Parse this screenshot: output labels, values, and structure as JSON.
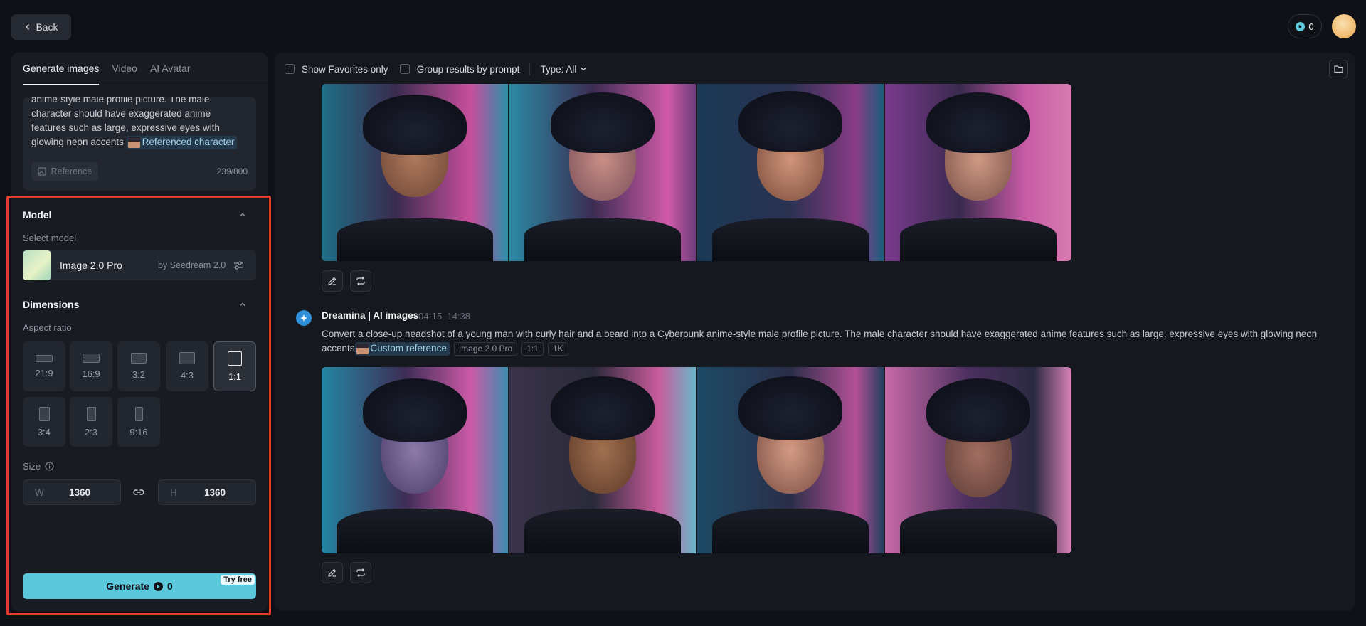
{
  "header": {
    "back_label": "Back",
    "credits": "0"
  },
  "left_panel": {
    "tabs": [
      {
        "label": "Generate images",
        "active": true
      },
      {
        "label": "Video",
        "active": false
      },
      {
        "label": "AI Avatar",
        "active": false
      }
    ],
    "prompt": {
      "lines": [
        "anime-style male profile picture. The male",
        "character should have exaggerated anime",
        "features such as large, expressive eyes with",
        "glowing neon accents"
      ],
      "reference_chip": "Referenced character",
      "reference_button": "Reference",
      "counter": "239/800"
    },
    "model_section": {
      "title": "Model",
      "select_label": "Select model",
      "model_name": "Image 2.0 Pro",
      "model_by": "by Seedream 2.0"
    },
    "dimensions_section": {
      "title": "Dimensions",
      "aspect_label": "Aspect ratio",
      "ratios": [
        "21:9",
        "16:9",
        "3:2",
        "4:3",
        "1:1",
        "3:4",
        "2:3",
        "9:16"
      ],
      "selected_ratio": "1:1",
      "size_label": "Size",
      "width_key": "W",
      "width_value": "1360",
      "height_key": "H",
      "height_value": "1360"
    },
    "generate": {
      "label": "Generate",
      "cost": "0",
      "badge": "Try free"
    }
  },
  "results": {
    "toolbar": {
      "favorites_label": "Show Favorites only",
      "group_label": "Group results by prompt",
      "type_label": "Type: All"
    },
    "entry": {
      "author": "Dreamina | AI images",
      "date": "04-15",
      "time": "14:38",
      "prompt": "Convert a close-up headshot of a young man with curly hair and a beard into a Cyberpunk anime-style male profile picture. The male character should have exaggerated anime features such as large, expressive eyes with glowing neon accents",
      "reference_chip": "Custom reference",
      "tags": [
        "Image 2.0 Pro",
        "1:1",
        "1K"
      ]
    }
  },
  "colors": {
    "accent": "#5bc8dc",
    "highlight_frame": "#e53b2c",
    "panel": "#181b22",
    "background": "#0f1116"
  }
}
